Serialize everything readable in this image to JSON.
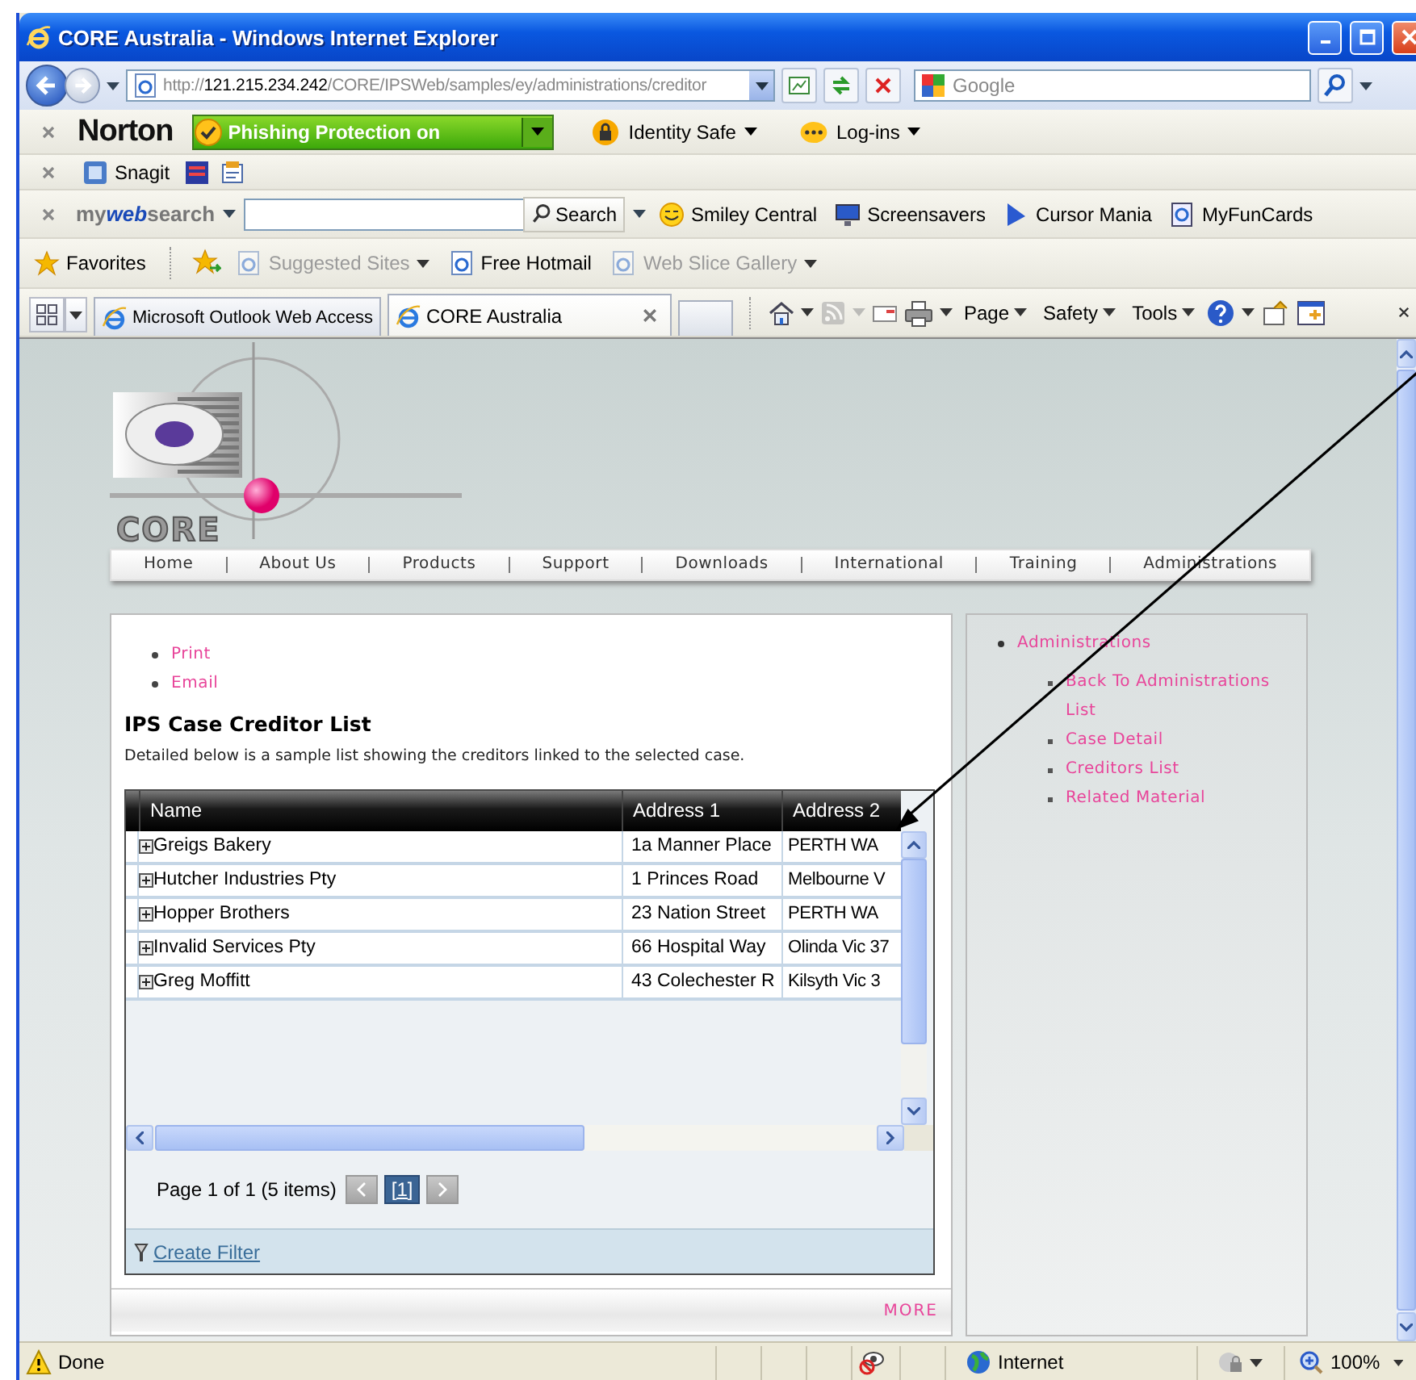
{
  "window": {
    "title": "CORE Australia - Windows Internet Explorer"
  },
  "address_bar": {
    "scheme": "http://",
    "host": "121.215.234.242",
    "path": "/CORE/IPSWeb/samples/ey/administrations/creditor"
  },
  "search_box": {
    "placeholder": "Google"
  },
  "norton_toolbar": {
    "brand": "Norton",
    "phishing_status": "Phishing Protection on",
    "items": [
      "Identity Safe",
      "Log-ins"
    ]
  },
  "snagit_toolbar": {
    "label": "Snagit"
  },
  "mywebsearch_toolbar": {
    "brand": {
      "prefix": "my",
      "highlight": "web",
      "suffix": "search"
    },
    "search_button": "Search",
    "links": [
      "Smiley Central",
      "Screensavers",
      "Cursor Mania",
      "MyFunCards"
    ]
  },
  "favorites_bar": {
    "label": "Favorites",
    "items": [
      {
        "label": "Suggested Sites",
        "disabled": true,
        "menu": true
      },
      {
        "label": "Free Hotmail",
        "disabled": false,
        "menu": false
      },
      {
        "label": "Web Slice Gallery",
        "disabled": true,
        "menu": true
      }
    ]
  },
  "tabs": [
    {
      "label": "Microsoft Outlook Web Access",
      "selected": false
    },
    {
      "label": "CORE Australia",
      "selected": true
    }
  ],
  "command_bar": [
    "Page",
    "Safety",
    "Tools"
  ],
  "page": {
    "logo": "CORE",
    "nav": [
      "Home",
      "About Us",
      "Products",
      "Support",
      "Downloads",
      "International",
      "Training",
      "Administrations"
    ],
    "actions": [
      "Print",
      "Email"
    ],
    "heading": "IPS Case Creditor List",
    "description": "Detailed below is a sample list showing the creditors linked to the selected case.",
    "grid": {
      "columns": [
        "Name",
        "Address 1",
        "Address 2"
      ],
      "rows": [
        [
          "Greigs Bakery",
          "1a Manner Place",
          "PERTH WA"
        ],
        [
          "Hutcher Industries Pty",
          "1 Princes Road",
          "Melbourne V"
        ],
        [
          "Hopper Brothers",
          "23 Nation Street",
          "PERTH WA"
        ],
        [
          "Invalid Services Pty",
          "66 Hospital Way",
          "Olinda Vic 37"
        ],
        [
          "Greg Moffitt",
          "43 Colechester R",
          "Kilsyth Vic 3"
        ]
      ],
      "pager": {
        "summary": "Page 1 of 1 (5 items)",
        "prev_disabled": true,
        "next_disabled": true,
        "pages": [
          {
            "label": "[1]",
            "selected": true
          }
        ]
      },
      "filter_link": "Create Filter"
    },
    "more_link": "MORE",
    "sidebar": {
      "title": "Administrations",
      "items": [
        "Back To Administrations List",
        "Case Detail",
        "Creditors List",
        "Related Material"
      ]
    }
  },
  "status_bar": {
    "text": "Done",
    "zone": "Internet",
    "zoom": "100%"
  }
}
